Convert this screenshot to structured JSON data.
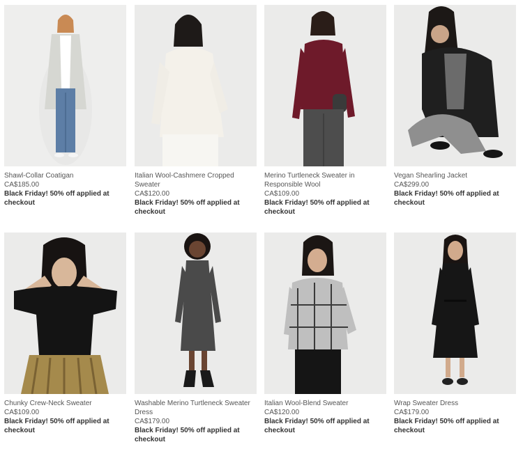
{
  "products": [
    {
      "name": "Shawl-Collar Coatigan",
      "price": "CA$185.00",
      "promo": "Black Friday! 50% off applied at checkout",
      "image": "model-in-light-grey-coatigan"
    },
    {
      "name": "Italian Wool-Cashmere Cropped Sweater",
      "price": "CA$120.00",
      "promo": "Black Friday! 50% off applied at checkout",
      "image": "model-in-ivory-sweater"
    },
    {
      "name": "Merino Turtleneck Sweater in Responsible Wool",
      "price": "CA$109.00",
      "promo": "Black Friday! 50% off applied at checkout",
      "image": "model-in-burgundy-turtleneck"
    },
    {
      "name": "Vegan Shearling Jacket",
      "price": "CA$299.00",
      "promo": "Black Friday! 50% off applied at checkout",
      "image": "model-in-black-shearling-jacket"
    },
    {
      "name": "Chunky Crew-Neck Sweater",
      "price": "CA$109.00",
      "promo": "Black Friday! 50% off applied at checkout",
      "image": "model-in-black-crew-neck-sweater"
    },
    {
      "name": "Washable Merino Turtleneck Sweater Dress",
      "price": "CA$179.00",
      "promo": "Black Friday! 50% off applied at checkout",
      "image": "model-in-charcoal-sweater-dress"
    },
    {
      "name": "Italian Wool-Blend Sweater",
      "price": "CA$120.00",
      "promo": "Black Friday! 50% off applied at checkout",
      "image": "model-in-grey-windowpane-sweater"
    },
    {
      "name": "Wrap Sweater Dress",
      "price": "CA$179.00",
      "promo": "Black Friday! 50% off applied at checkout",
      "image": "model-in-black-wrap-dress"
    }
  ],
  "colors": {
    "photo_bg": "#e9e9e8",
    "text_muted": "#555555",
    "text_promo": "#333333"
  }
}
